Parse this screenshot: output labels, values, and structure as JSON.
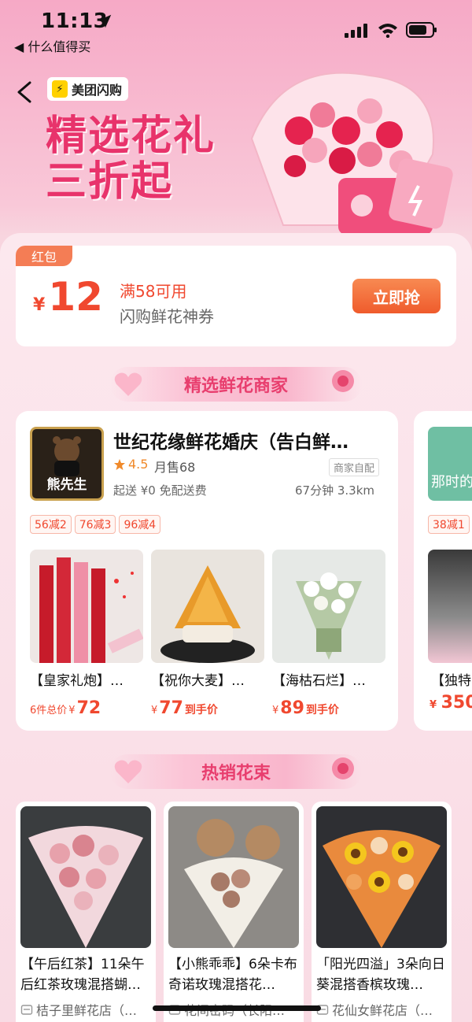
{
  "status_bar": {
    "time": "11:13",
    "back_app": "◀ 什么值得买"
  },
  "hero": {
    "brand": "美团闪购",
    "title_line1": "精选花礼",
    "title_line2": "三折起"
  },
  "coupon": {
    "tag": "红包",
    "currency": "¥",
    "amount": "12",
    "condition": "满58可用",
    "description": "闪购鲜花神券",
    "button": "立即抢"
  },
  "sections": {
    "merchants_title": "精选鲜花商家",
    "hot_title": "热销花束"
  },
  "merchant": {
    "logo_text": "熊先生",
    "name": "世纪花缘鲜花婚庆（告白鲜…",
    "rating": "4.5",
    "monthly_sales": "月售68",
    "badge": "商家自配",
    "delivery": "起送 ¥0  免配送费",
    "eta": "67分钟  3.3km",
    "discounts": [
      "56减2",
      "76减3",
      "96减4"
    ],
    "products": [
      {
        "name": "【皇家礼炮】…",
        "prefix": "6件总价",
        "currency": "¥",
        "price": "72",
        "suffix": ""
      },
      {
        "name": "【祝你大麦】…",
        "prefix": "",
        "currency": "¥",
        "price": "77",
        "suffix": "到手价"
      },
      {
        "name": "【海枯石烂】…",
        "prefix": "",
        "currency": "¥",
        "price": "89",
        "suffix": "到手价"
      }
    ]
  },
  "merchant2": {
    "logo_text": "那时的",
    "discount": "38减1",
    "product_name": "【独特",
    "currency": "¥",
    "price": "350"
  },
  "hot_items": [
    {
      "title": "【午后红茶】11朵午后红茶玫瑰混搭蝴…",
      "shop": "桔子里鲜花店（…"
    },
    {
      "title": "【小熊乖乖】6朵卡布奇诺玫瑰混搭花…",
      "shop": "花间密码（长阳…"
    },
    {
      "title": "「阳光四溢」3朵向日葵混搭香槟玫瑰…",
      "shop": "花仙女鲜花店（…"
    }
  ],
  "colors": {
    "accent": "#e8336b",
    "price": "#f0482f",
    "button": "#ef5b2c"
  }
}
